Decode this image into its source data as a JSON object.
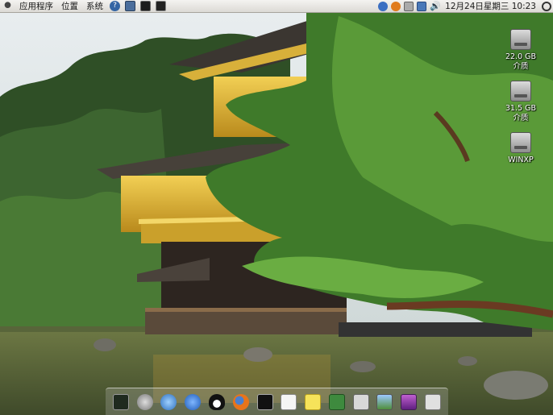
{
  "top_panel": {
    "logo_icon": "ubuntu-foot-icon",
    "menus": [
      "应用程序",
      "位置",
      "系统"
    ],
    "launchers": [
      "help-icon",
      "save-icon",
      "system-monitor-icon",
      "terminal-icon"
    ],
    "tray": [
      "music-note-icon",
      "update-notifier-icon",
      "keyboard-icon",
      "network-icon"
    ],
    "volume_icon": "speaker-icon",
    "clock": "12月24日星期三 10:23",
    "power_icon": "power-icon"
  },
  "desktop_icons": [
    {
      "label": "22.0 GB 介质",
      "icon": "hard-drive-icon"
    },
    {
      "label": "31.5 GB 介质",
      "icon": "hard-drive-icon"
    },
    {
      "label": "WINXP",
      "icon": "hard-drive-icon"
    }
  ],
  "dock": [
    "system-monitor-icon",
    "seahorse-icon",
    "itunes-icon",
    "video-chat-icon",
    "qq-penguin-icon",
    "firefox-icon",
    "terminal-icon",
    "document-icon",
    "sticky-notes-icon",
    "book-icon",
    "calculator-icon",
    "image-viewer-icon",
    "media-player-icon",
    "settings-tools-icon"
  ],
  "colors": {
    "panel": "#dcdad5",
    "sky": "#dfe7ea",
    "foliage": "#2e5a22",
    "pavilion_gold": "#d9a928",
    "water": "#5d6a3c"
  }
}
